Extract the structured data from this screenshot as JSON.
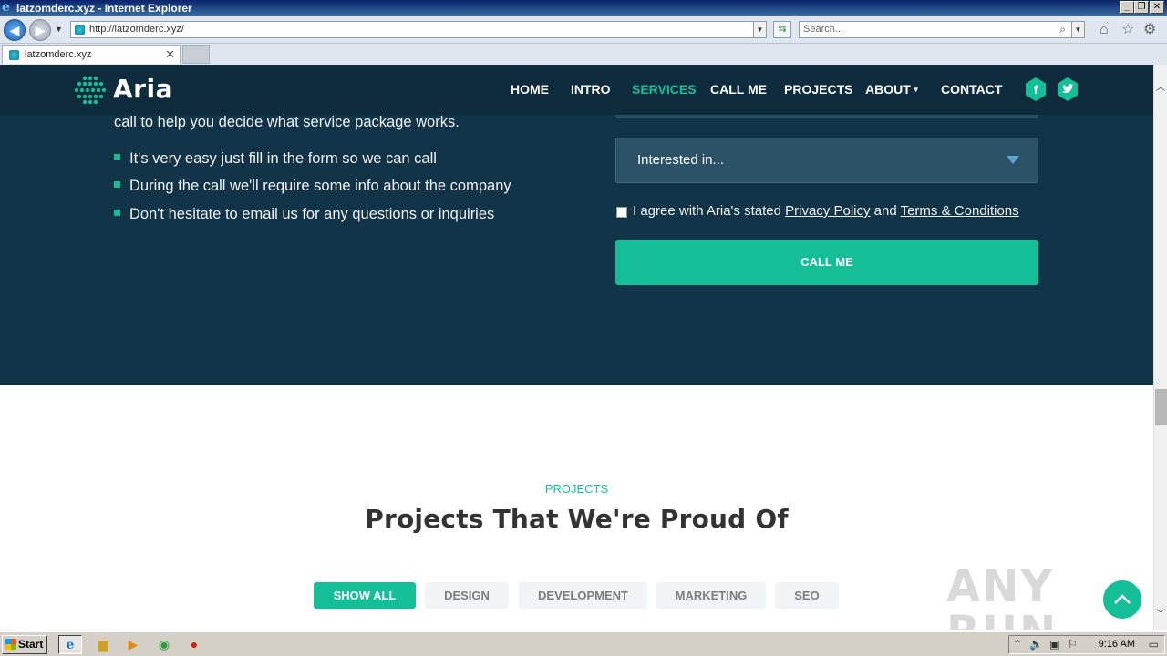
{
  "browser": {
    "window_title": "latzomderc.xyz - Internet Explorer",
    "address": "http://latzomderc.xyz/",
    "search_placeholder": "Search...",
    "tab_title": "latzomderc.xyz"
  },
  "site": {
    "logo_text": "Aria",
    "nav": [
      {
        "label": "HOME"
      },
      {
        "label": "INTRO"
      },
      {
        "label": "SERVICES"
      },
      {
        "label": "CALL ME"
      },
      {
        "label": "PROJECTS"
      },
      {
        "label": "ABOUT"
      },
      {
        "label": "CONTACT"
      }
    ],
    "active_nav": "SERVICES",
    "accent_color": "#14bf98",
    "dark_bg_color": "#113448"
  },
  "callme": {
    "intro_tail": "call to help you decide what service package works.",
    "bullets": [
      "It's very easy just fill in the form so we can call",
      "During the call we'll require some info about the company",
      "Don't hesitate to email us for any questions or inquiries"
    ],
    "select_placeholder": "Interested in...",
    "agree_prefix": "I agree with Aria's stated",
    "privacy_link": "Privacy Policy",
    "agree_and": "and",
    "terms_link": "Terms & Conditions",
    "submit_label": "CALL ME"
  },
  "projects": {
    "label": "PROJECTS",
    "title": "Projects That We're Proud Of",
    "filters": [
      "SHOW ALL",
      "DESIGN",
      "DEVELOPMENT",
      "MARKETING",
      "SEO"
    ],
    "active_filter": "SHOW ALL"
  },
  "watermark": "ANY RUN",
  "taskbar": {
    "start_label": "Start",
    "time": "9:16 AM"
  }
}
